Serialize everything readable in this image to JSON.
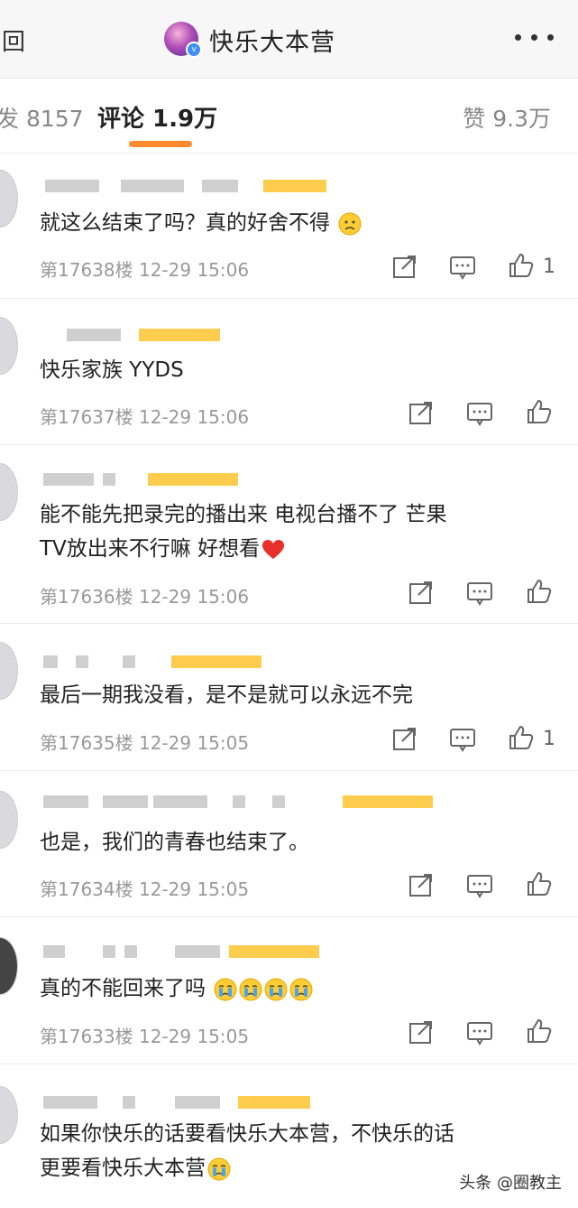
{
  "header": {
    "back_label": "回",
    "account_name": "快乐大本营"
  },
  "tabs": {
    "repost": "发 8157",
    "comment": "评论 1.9万",
    "like": "赞 9.3万"
  },
  "comments": [
    {
      "text": "就这么结束了吗？真的好舍不得",
      "meta": "第17638楼  12-29 15:06",
      "like_count": "1",
      "emoji": "sad"
    },
    {
      "text": "快乐家族 YYDS",
      "meta": "第17637楼  12-29 15:06",
      "like_count": ""
    },
    {
      "text_line1": "能不能先把录完的播出来  电视台播不了 芒果",
      "text_line2": "TV放出来不行嘛 好想看",
      "meta": "第17636楼  12-29 15:06",
      "like_count": "",
      "emoji": "heart"
    },
    {
      "text": "最后一期我没看，是不是就可以永远不完",
      "meta": "第17635楼  12-29 15:05",
      "like_count": "1"
    },
    {
      "text": "也是，我们的青春也结束了。",
      "meta": "第17634楼  12-29 15:05",
      "like_count": ""
    },
    {
      "text": "真的不能回来了吗",
      "meta": "第17633楼  12-29 15:05",
      "like_count": "",
      "emoji": "cry x4"
    },
    {
      "text_line1": "如果你快乐的话要看快乐大本营，不快乐的话",
      "text_line2": "更要看快乐大本营",
      "meta": "",
      "like_count": "",
      "emoji": "cry"
    }
  ],
  "watermark": "头条 @圈教主",
  "colors": {
    "accent": "#ff8a2b",
    "meta": "#999999"
  }
}
